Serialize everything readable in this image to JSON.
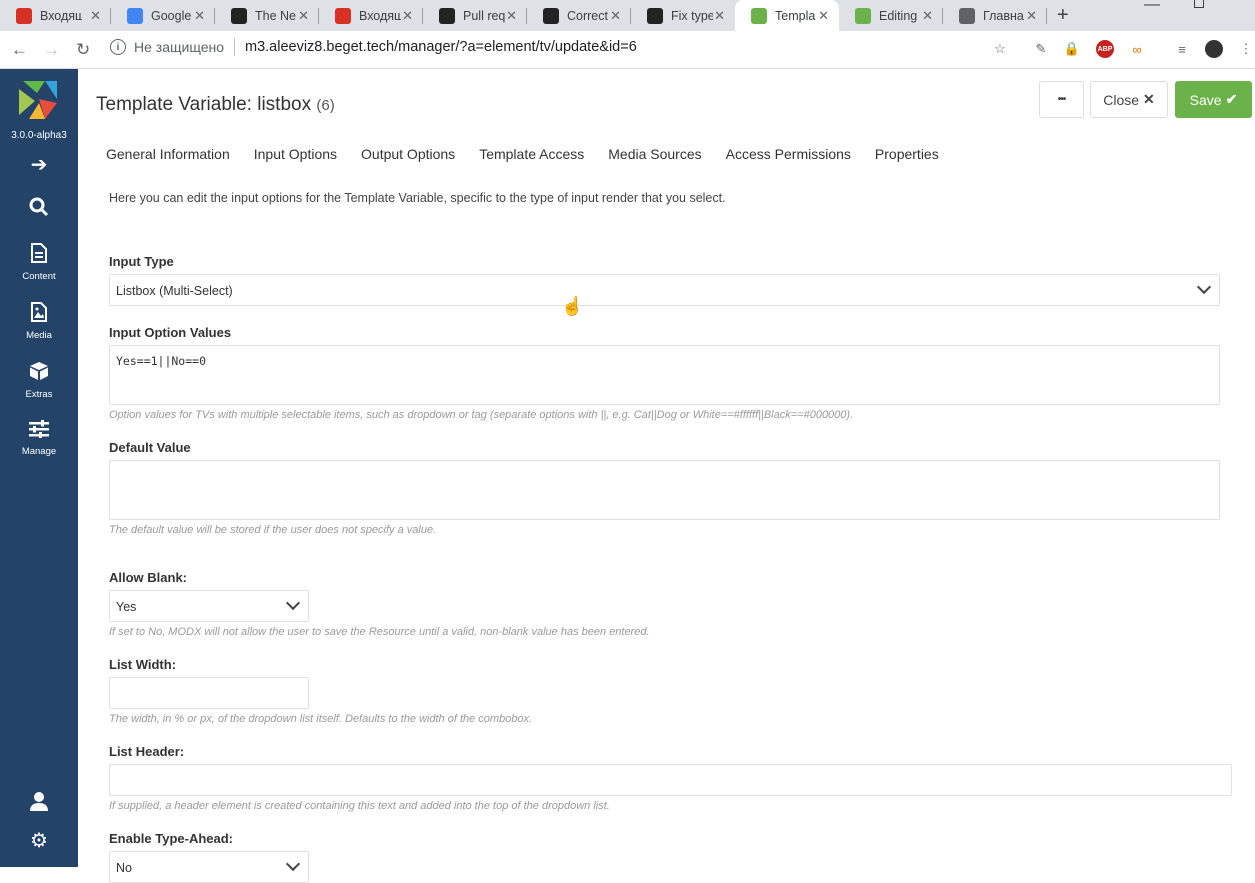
{
  "browser": {
    "tabs": [
      {
        "title": "Входящ",
        "icon": "gmail-icon",
        "color": "#d93025",
        "active": false
      },
      {
        "title": "Google",
        "icon": "google-translate-icon",
        "color": "#4285f4",
        "active": false
      },
      {
        "title": "The Ne",
        "icon": "pause-icon",
        "color": "#222222",
        "active": false
      },
      {
        "title": "Входящ",
        "icon": "gmail-icon",
        "color": "#d93025",
        "active": false
      },
      {
        "title": "Pull req",
        "icon": "github-icon",
        "color": "#222222",
        "active": false
      },
      {
        "title": "Correct",
        "icon": "github-icon",
        "color": "#222222",
        "active": false
      },
      {
        "title": "Fix type",
        "icon": "github-icon",
        "color": "#222222",
        "active": false
      },
      {
        "title": "Templa",
        "icon": "modx-icon",
        "color": "#6cb24a",
        "active": true
      },
      {
        "title": "Editing",
        "icon": "modx-icon",
        "color": "#6cb24a",
        "active": false
      },
      {
        "title": "Главна",
        "icon": "globe-icon",
        "color": "#5f6368",
        "active": false
      }
    ],
    "address": {
      "security_label": "Не защищено",
      "url": "m3.aleeviz8.beget.tech/manager/?a=element/tv/update&id=6"
    }
  },
  "sidebar": {
    "version": "3.0.0-alpha3",
    "items": [
      {
        "icon": "arrow-right-icon",
        "label": ""
      },
      {
        "icon": "search-icon",
        "label": ""
      },
      {
        "icon": "document-icon",
        "label": "Content"
      },
      {
        "icon": "media-icon",
        "label": "Media"
      },
      {
        "icon": "box-icon",
        "label": "Extras"
      },
      {
        "icon": "sliders-icon",
        "label": "Manage"
      }
    ],
    "bottom": [
      {
        "icon": "user-icon"
      },
      {
        "icon": "gear-icon"
      }
    ]
  },
  "header": {
    "title": "Template Variable: listbox",
    "count": "(6)",
    "more_label": "•••",
    "close_label": "Close",
    "save_label": "Save"
  },
  "tabs": [
    "General Information",
    "Input Options",
    "Output Options",
    "Template Access",
    "Media Sources",
    "Access Permissions",
    "Properties"
  ],
  "intro": "Here you can edit the input options for the Template Variable, specific to the type of input render that you select.",
  "form": {
    "input_type": {
      "label": "Input Type",
      "value": "Listbox (Multi-Select)"
    },
    "option_values": {
      "label": "Input Option Values",
      "value": "Yes==1||No==0",
      "help": "Option values for TVs with multiple selectable items, such as dropdown or tag (separate options with ||, e.g. Cat||Dog or White==#ffffff||Black==#000000)."
    },
    "default_value": {
      "label": "Default Value",
      "value": "",
      "help": "The default value will be stored if the user does not specify a value."
    },
    "allow_blank": {
      "label": "Allow Blank:",
      "value": "Yes",
      "help": "If set to No, MODX will not allow the user to save the Resource until a valid, non-blank value has been entered."
    },
    "list_width": {
      "label": "List Width:",
      "value": "",
      "help": "The width, in % or px, of the dropdown list itself. Defaults to the width of the combobox."
    },
    "list_header": {
      "label": "List Header:",
      "value": "",
      "help": "If supplied, a header element is created containing this text and added into the top of the dropdown list."
    },
    "type_ahead": {
      "label": "Enable Type-Ahead:",
      "value": "No"
    }
  },
  "colors": {
    "sidebar": "#234368",
    "save": "#6cb24a"
  }
}
